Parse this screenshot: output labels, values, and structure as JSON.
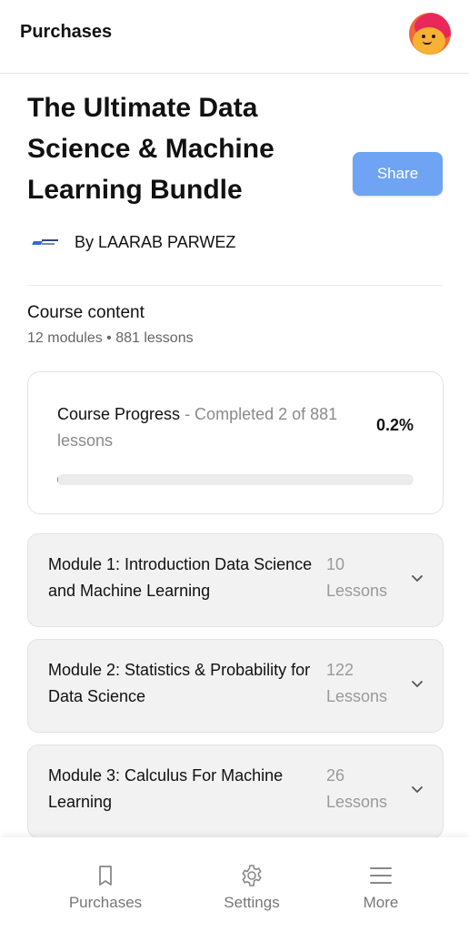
{
  "header": {
    "title": "Purchases"
  },
  "course": {
    "title": "The Ultimate Data Science & Machine Learning Bundle",
    "share_label": "Share",
    "author": "By LAARAB PARWEZ"
  },
  "content": {
    "heading": "Course content",
    "meta": "12 modules • 881 lessons"
  },
  "progress": {
    "label": "Course Progress",
    "detail": " - Completed 2 of 881 lessons",
    "percent_text": "0.2%",
    "fraction": 0.0023,
    "fill_color": "#2aa8a0"
  },
  "modules": [
    {
      "title": "Module 1: Introduction Data Science and Machine Learning",
      "lessons": "10 Lessons"
    },
    {
      "title": "Module 2: Statistics & Probability for Data Science",
      "lessons": "122 Lessons"
    },
    {
      "title": "Module 3: Calculus For Machine Learning",
      "lessons": "26 Lessons"
    }
  ],
  "nav": [
    {
      "label": "Purchases",
      "icon": "bookmark-icon"
    },
    {
      "label": "Settings",
      "icon": "gear-icon"
    },
    {
      "label": "More",
      "icon": "menu-icon"
    }
  ],
  "colors": {
    "share_button": "#6ea4f3",
    "module_bg": "#f2f2f2"
  }
}
